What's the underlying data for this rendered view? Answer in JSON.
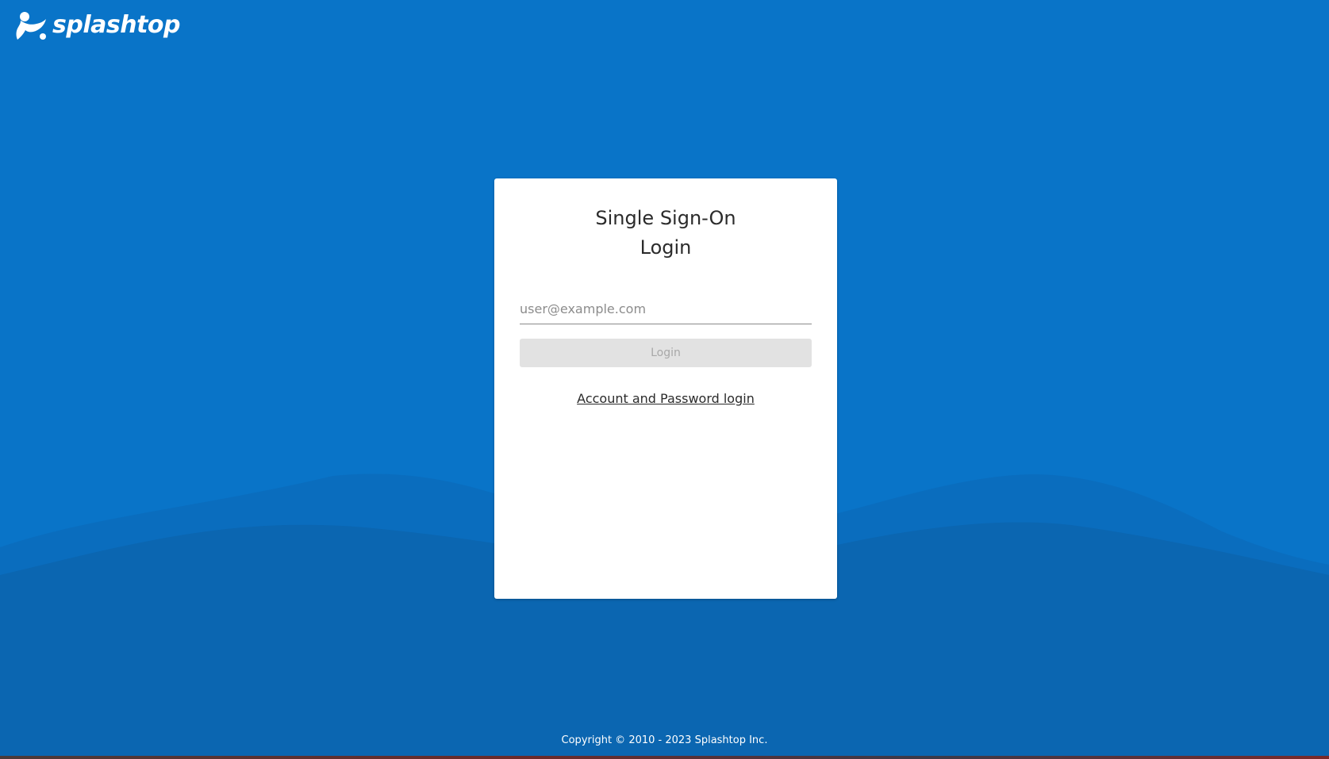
{
  "brand": {
    "name": "splashtop",
    "icon": "splashtop-logo-icon"
  },
  "login_card": {
    "title_line1": "Single Sign-On",
    "title_line2": "Login",
    "email_placeholder": "user@example.com",
    "email_value": "",
    "login_button_label": "Login",
    "login_button_enabled": false,
    "alt_login_link": "Account and Password login"
  },
  "footer": {
    "copyright": "Copyright © 2010 - 2023 Splashtop Inc."
  },
  "colors": {
    "background": "#0974c8",
    "wave_light": "#0a6cbc",
    "wave_dark": "#0b66b0",
    "card": "#ffffff",
    "button_disabled_bg": "#e2e2e2",
    "button_disabled_text": "#a8a8a8"
  }
}
